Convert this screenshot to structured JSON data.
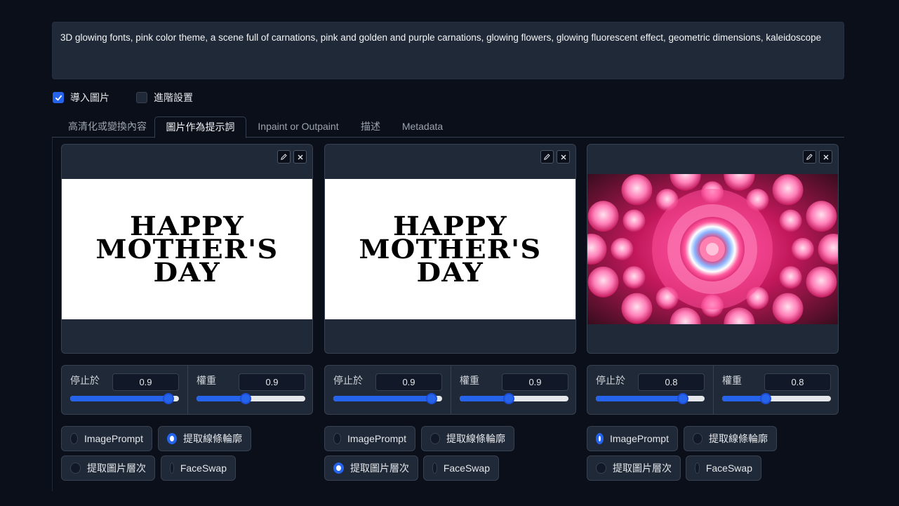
{
  "prompt": {
    "text": "3D glowing fonts, pink color theme, a scene full of carnations, pink and golden and purple carnations, glowing flowers, glowing fluorescent effect, geometric dimensions, kaleidoscope"
  },
  "options": {
    "import_image": {
      "label": "導入圖片",
      "checked": true
    },
    "advanced": {
      "label": "進階設置",
      "checked": false
    }
  },
  "tabs": [
    {
      "label": "高清化或變換內容"
    },
    {
      "label": "圖片作為提示詞",
      "active": true
    },
    {
      "label": "Inpaint or Outpaint"
    },
    {
      "label": "描述"
    },
    {
      "label": "Metadata"
    }
  ],
  "image_text": {
    "line1": "HAPPY",
    "line2": "MOTHER'S",
    "line3": "DAY"
  },
  "icons": {
    "edit": "pencil-icon",
    "close": "close-icon"
  },
  "slots": [
    {
      "image": "happy-mothers-day-text",
      "stop_at": {
        "label": "停止於",
        "value": "0.9",
        "fraction": 0.9
      },
      "weight": {
        "label": "權重",
        "value": "0.9",
        "fraction": 0.45
      },
      "radios": [
        {
          "label": "ImagePrompt",
          "selected": false
        },
        {
          "label": "提取線條輪廓",
          "selected": true
        },
        {
          "label": "提取圖片層次",
          "selected": false
        },
        {
          "label": "FaceSwap",
          "selected": false
        }
      ]
    },
    {
      "image": "happy-mothers-day-text",
      "stop_at": {
        "label": "停止於",
        "value": "0.9",
        "fraction": 0.9
      },
      "weight": {
        "label": "權重",
        "value": "0.9",
        "fraction": 0.45
      },
      "radios": [
        {
          "label": "ImagePrompt",
          "selected": false
        },
        {
          "label": "提取線條輪廓",
          "selected": false
        },
        {
          "label": "提取圖片層次",
          "selected": true
        },
        {
          "label": "FaceSwap",
          "selected": false
        }
      ]
    },
    {
      "image": "pink-carnation-kaleidoscope",
      "stop_at": {
        "label": "停止於",
        "value": "0.8",
        "fraction": 0.8
      },
      "weight": {
        "label": "權重",
        "value": "0.8",
        "fraction": 0.4
      },
      "radios": [
        {
          "label": "ImagePrompt",
          "selected": true
        },
        {
          "label": "提取線條輪廓",
          "selected": false
        },
        {
          "label": "提取圖片層次",
          "selected": false
        },
        {
          "label": "FaceSwap",
          "selected": false
        }
      ]
    }
  ],
  "colors": {
    "accent": "#2563eb",
    "panel": "#1f2937",
    "background": "#0b0f19"
  }
}
